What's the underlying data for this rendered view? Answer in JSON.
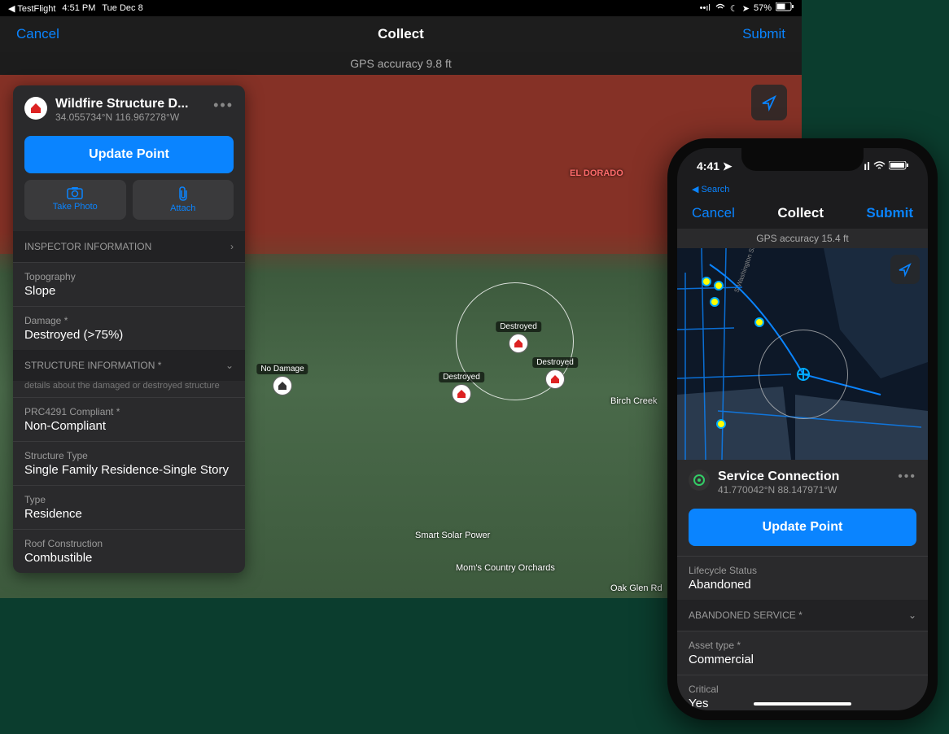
{
  "ipad": {
    "statusbar": {
      "app": "TestFlight",
      "time": "4:51 PM",
      "date": "Tue Dec 8",
      "battery": "57%"
    },
    "nav": {
      "cancel": "Cancel",
      "title": "Collect",
      "submit": "Submit"
    },
    "gps": "GPS accuracy 9.8 ft",
    "map": {
      "region_label": "EL DORADO",
      "labels": {
        "nodamage": "No Damage",
        "destroyed1": "Destroyed",
        "destroyed2": "Destroyed",
        "destroyed3": "Destroyed",
        "birch_creek": "Birch Creek",
        "smart_solar": "Smart Solar Power",
        "moms": "Mom's Country Orchards",
        "oak_glen": "Oak Glen Rd"
      }
    },
    "panel": {
      "title": "Wildfire Structure D...",
      "coords": "34.055734°N  116.967278°W",
      "update_btn": "Update Point",
      "take_photo": "Take Photo",
      "attach": "Attach",
      "sections": {
        "inspector": {
          "header": "INSPECTOR INFORMATION"
        },
        "structure": {
          "header": "STRUCTURE INFORMATION *",
          "desc": "details about the damaged or destroyed structure"
        }
      },
      "fields": {
        "topography": {
          "label": "Topography",
          "value": "Slope"
        },
        "damage": {
          "label": "Damage *",
          "value": "Destroyed (>75%)"
        },
        "prc": {
          "label": "PRC4291 Compliant *",
          "value": "Non-Compliant"
        },
        "struct_type": {
          "label": "Structure Type",
          "value": "Single Family Residence-Single Story"
        },
        "type": {
          "label": "Type",
          "value": "Residence"
        },
        "roof": {
          "label": "Roof Construction",
          "value": "Combustible"
        }
      }
    }
  },
  "iphone": {
    "statusbar": {
      "time": "4:41",
      "back": "Search"
    },
    "nav": {
      "cancel": "Cancel",
      "title": "Collect",
      "submit": "Submit"
    },
    "gps": "GPS accuracy 15.4 ft",
    "map": {
      "street": "S Washington St"
    },
    "panel": {
      "title": "Service Connection",
      "coords": "41.770042°N  88.147971°W",
      "update_btn": "Update Point",
      "fields": {
        "lifecycle": {
          "label": "Lifecycle Status",
          "value": "Abandoned"
        },
        "asset_type": {
          "label": "Asset type *",
          "value": "Commercial"
        },
        "critical": {
          "label": "Critical",
          "value": "Yes"
        }
      },
      "sections": {
        "abandoned": {
          "header": "ABANDONED SERVICE *"
        }
      }
    }
  }
}
